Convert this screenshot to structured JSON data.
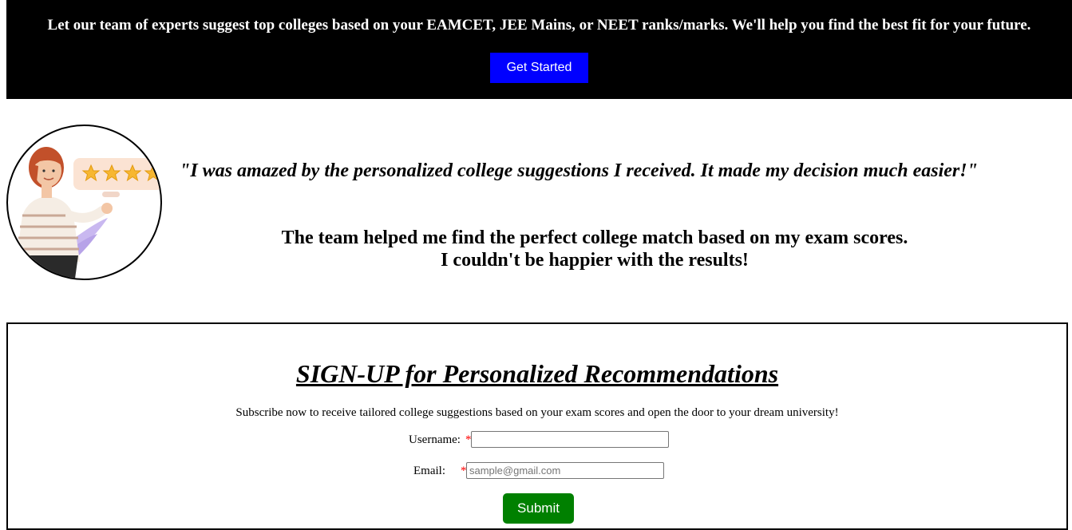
{
  "hero": {
    "text": "Let our team of experts suggest top colleges based on your EAMCET, JEE Mains, or NEET ranks/marks. We'll help you find the best fit for your future.",
    "cta_label": "Get Started"
  },
  "testimonial": {
    "quote": "\"I was amazed by the personalized college suggestions I received. It made my decision much easier!\"",
    "line1": "The team helped me find the perfect college match based on my exam scores.",
    "line2": "I couldn't be happier with the results!",
    "avatar_icon": "woman-with-rating-stars-illustration"
  },
  "signup": {
    "title": "SIGN-UP for Personalized Recommendations",
    "description": "Subscribe now to receive tailored college suggestions based on your exam scores and open the door to your dream university!",
    "username_label": "Username:",
    "username_value": "",
    "email_label": "Email:",
    "email_value": "",
    "email_placeholder": "sample@gmail.com",
    "required_marker": "*",
    "submit_label": "Submit"
  },
  "colors": {
    "hero_bg": "#000000",
    "cta_bg": "#0000ff",
    "submit_bg": "#008000",
    "required": "#ff0000",
    "star": "#f7b731"
  }
}
